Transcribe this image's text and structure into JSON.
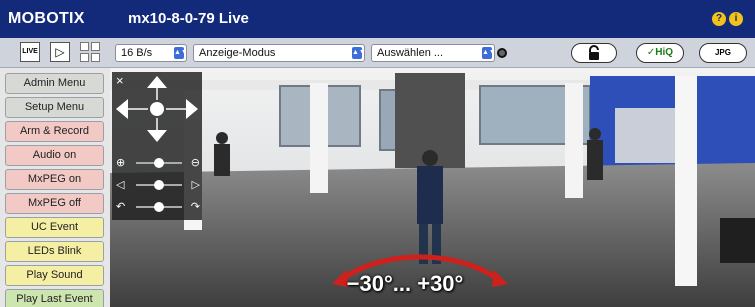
{
  "app": {
    "brand": "MOBOTIX",
    "camera_title": "mx10-8-0-79 Live",
    "help_icons": [
      "?",
      "i"
    ]
  },
  "toolbar": {
    "live_label": "LIVE",
    "play_icon": "play-icon",
    "grid_icon": "grid-icon",
    "framerate": "16 B/s",
    "display_mode": "Anzeige-Modus",
    "select": "Auswählen ...",
    "lock_icon": "padlock-icon",
    "hiq_label": "✓HiQ",
    "jpeg_label": "JPG"
  },
  "sidebar": {
    "buttons": [
      {
        "label": "Admin Menu",
        "color": "#d7d9d5"
      },
      {
        "label": "Setup Menu",
        "color": "#d7d9d5"
      },
      {
        "label": "Arm & Record",
        "color": "#f2c9c4"
      },
      {
        "label": "Audio on",
        "color": "#f2c9c4"
      },
      {
        "label": "MxPEG on",
        "color": "#f2c9c4"
      },
      {
        "label": "MxPEG off",
        "color": "#f2c9c4"
      },
      {
        "label": "UC Event",
        "color": "#f5efa4"
      },
      {
        "label": "LEDs Blink",
        "color": "#f5efa4"
      },
      {
        "label": "Play Sound",
        "color": "#f5efa4"
      },
      {
        "label": "Play Last Event",
        "color": "#cde6b0"
      }
    ]
  },
  "ptz": {
    "close": "×",
    "rows": [
      {
        "left": "⊕",
        "right": "⊖"
      },
      {
        "left": "◁",
        "right": "▷"
      },
      {
        "left": "↶",
        "right": "↷"
      }
    ]
  },
  "overlay": {
    "angle_label": "−30°... +30°",
    "arc_color": "#d0201c"
  }
}
